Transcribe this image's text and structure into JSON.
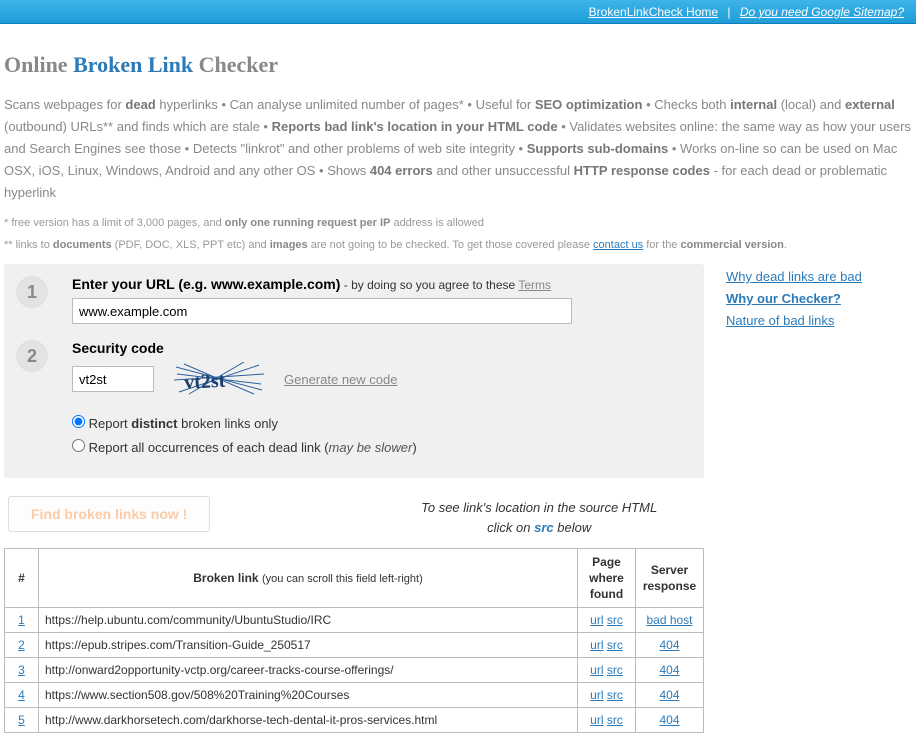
{
  "topbar": {
    "home": "BrokenLinkCheck Home",
    "sitemap": "Do you need Google Sitemap?"
  },
  "title": {
    "pre": "Online ",
    "mid": "Broken Link",
    "post": " Checker"
  },
  "desc": "Scans webpages for <b>dead</b> hyperlinks • Can analyse unlimited number of pages* • Useful for <b>SEO optimization</b> • Checks both <b>internal</b> (local) and <b>external</b> (outbound) URLs** and finds which are stale • <b>Reports bad link's location in your HTML code</b> • Validates websites online: the same way as how your users and Search Engines see those • Detects \"linkrot\" and other problems of web site integrity • <b>Supports sub-domains</b> • Works on-line so can be used on Mac OSX, iOS, Linux, Windows, Android and any other OS • Shows <b>404 errors</b> and other unsuccessful <b>HTTP response codes</b> - for each dead or problematic hyperlink",
  "note1": "*  free version has a limit of 3,000 pages, and <b>only one running request per IP</b> address is allowed",
  "note2_a": "** links to <b>documents</b> (PDF, DOC, XLS, PPT etc) and <b>images</b> are not going to be checked. To get those covered please ",
  "note2_link": "contact us",
  "note2_b": " for the <b>commercial version</b>.",
  "form": {
    "url_label_bold": "Enter your URL (e.g. www.example.com)",
    "url_label_small": " - by doing so you agree to these ",
    "terms": "Terms",
    "url_value": "www.example.com",
    "sec_label": "Security code",
    "sec_value": "vt2st",
    "captcha_text": "vt2st",
    "gen": "Generate new code",
    "radio1_a": "Report ",
    "radio1_b": "distinct",
    "radio1_c": " broken links only",
    "radio2_a": "Report all occurrences of each dead link (",
    "radio2_i": "may be slower",
    "radio2_b": ")",
    "button": "Find broken links now !",
    "hint_a": "To see link's location in the source HTML",
    "hint_b": "click on ",
    "hint_src": "src",
    "hint_c": " below"
  },
  "table": {
    "h_num": "#",
    "h_link": "Broken link",
    "h_link_sub": "(you can scroll this field left-right)",
    "h_page": "Page where found",
    "h_resp": "Server response",
    "url": "url",
    "src": "src",
    "rows": [
      {
        "n": "1",
        "link": "https://help.ubuntu.com/community/UbuntuStudio/IRC",
        "resp": "bad host"
      },
      {
        "n": "2",
        "link": "https://epub.stripes.com/Transition-Guide_250517",
        "resp": "404"
      },
      {
        "n": "3",
        "link": "http://onward2opportunity-vctp.org/career-tracks-course-offerings/",
        "resp": "404"
      },
      {
        "n": "4",
        "link": "https://www.section508.gov/508%20Training%20Courses",
        "resp": "404"
      },
      {
        "n": "5",
        "link": "http://www.darkhorsetech.com/darkhorse-tech-dental-it-pros-services.html",
        "resp": "404"
      }
    ]
  },
  "sidebar": {
    "l1": "Why dead links are bad",
    "l2": "Why our Checker?",
    "l3": "Nature of bad links"
  }
}
